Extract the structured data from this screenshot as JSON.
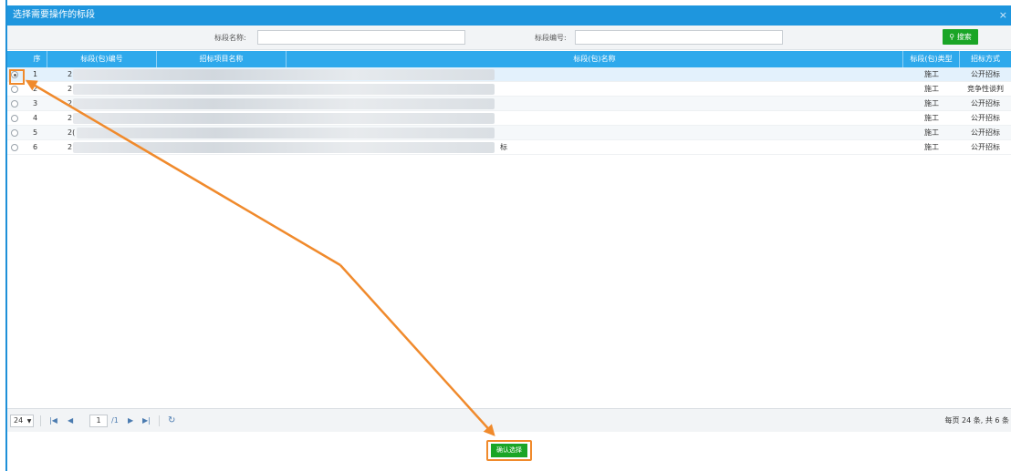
{
  "dialog": {
    "title": "选择需要操作的标段",
    "close": "×"
  },
  "search": {
    "name_label": "标段名称:",
    "code_label": "标段编号:",
    "name_value": "",
    "code_value": "",
    "button": "搜索"
  },
  "columns": [
    "序",
    "标段(包)编号",
    "招标项目名称",
    "标段(包)名称",
    "标段(包)类型",
    "招标方式"
  ],
  "rows": [
    {
      "no": "1",
      "code": "2",
      "name_tail": "",
      "type": "施工",
      "method": "公开招标",
      "selected": true
    },
    {
      "no": "2",
      "code": "2",
      "name_tail": "",
      "type": "施工",
      "method": "竞争性谈判",
      "selected": false
    },
    {
      "no": "3",
      "code": "2",
      "name_tail": "",
      "type": "施工",
      "method": "公开招标",
      "selected": false
    },
    {
      "no": "4",
      "code": "2",
      "name_tail": "",
      "type": "施工",
      "method": "公开招标",
      "selected": false
    },
    {
      "no": "5",
      "code": "2(",
      "name_tail": "",
      "type": "施工",
      "method": "公开招标",
      "selected": false
    },
    {
      "no": "6",
      "code": "2",
      "name_tail": "标",
      "type": "施工",
      "method": "公开招标",
      "selected": false
    }
  ],
  "pager": {
    "page_size": "24",
    "page": "1",
    "total_pages": "/1",
    "info": "每页 24 条, 共 6 条"
  },
  "confirm_label": "确认选择",
  "colors": {
    "title_bar": "#1e96de",
    "header": "#2ea9ec",
    "accent": "#1aa526",
    "annotation": "#f08a2c"
  },
  "icons": [
    "close-icon",
    "search-icon",
    "first-page-icon",
    "prev-page-icon",
    "next-page-icon",
    "last-page-icon",
    "refresh-icon"
  ]
}
